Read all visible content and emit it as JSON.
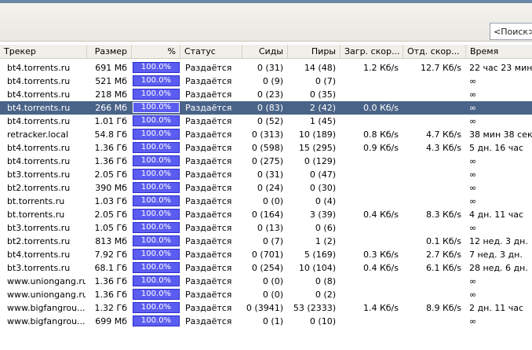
{
  "search": {
    "label": "<Поиск>"
  },
  "columns": {
    "tracker": "Трекер",
    "size": "Размер",
    "percent": "%",
    "status": "Статус",
    "seeds": "Сиды",
    "peers": "Пиры",
    "down": "Загр. скор...",
    "up": "Отд. скор...",
    "time": "Время"
  },
  "rows": [
    {
      "tracker": "bt4.torrents.ru",
      "size": "691 Мб",
      "percent": "100.0%",
      "status": "Раздаётся",
      "seeds": "0 (31)",
      "peers": "14 (48)",
      "down": "1.2 Кб/s",
      "up": "12.7 Кб/s",
      "time": "22 час 23 мин"
    },
    {
      "tracker": "bt4.torrents.ru",
      "size": "521 Мб",
      "percent": "100.0%",
      "status": "Раздаётся",
      "seeds": "0 (9)",
      "peers": "0 (7)",
      "down": "",
      "up": "",
      "time": "∞"
    },
    {
      "tracker": "bt4.torrents.ru",
      "size": "218 Мб",
      "percent": "100.0%",
      "status": "Раздаётся",
      "seeds": "0 (23)",
      "peers": "0 (35)",
      "down": "",
      "up": "",
      "time": "∞"
    },
    {
      "tracker": "bt4.torrents.ru",
      "size": "266 Мб",
      "percent": "100.0%",
      "status": "Раздаётся",
      "seeds": "0 (83)",
      "peers": "2 (42)",
      "down": "0.0 Кб/s",
      "up": "",
      "time": "∞",
      "selected": true
    },
    {
      "tracker": "bt4.torrents.ru",
      "size": "1.01 Гб",
      "percent": "100.0%",
      "status": "Раздаётся",
      "seeds": "0 (52)",
      "peers": "1 (45)",
      "down": "",
      "up": "",
      "time": "∞"
    },
    {
      "tracker": "retracker.local",
      "size": "54.8 Гб",
      "percent": "100.0%",
      "status": "Раздаётся",
      "seeds": "0 (313)",
      "peers": "10 (189)",
      "down": "0.8 Кб/s",
      "up": "4.7 Кб/s",
      "time": "38 мин 38 сек"
    },
    {
      "tracker": "bt4.torrents.ru",
      "size": "1.36 Гб",
      "percent": "100.0%",
      "status": "Раздаётся",
      "seeds": "0 (598)",
      "peers": "15 (295)",
      "down": "0.9 Кб/s",
      "up": "4.3 Кб/s",
      "time": "5 дн. 16 час"
    },
    {
      "tracker": "bt4.torrents.ru",
      "size": "1.36 Гб",
      "percent": "100.0%",
      "status": "Раздаётся",
      "seeds": "0 (275)",
      "peers": "0 (129)",
      "down": "",
      "up": "",
      "time": "∞"
    },
    {
      "tracker": "bt3.torrents.ru",
      "size": "2.05 Гб",
      "percent": "100.0%",
      "status": "Раздаётся",
      "seeds": "0 (31)",
      "peers": "0 (47)",
      "down": "",
      "up": "",
      "time": "∞"
    },
    {
      "tracker": "bt2.torrents.ru",
      "size": "390 Мб",
      "percent": "100.0%",
      "status": "Раздаётся",
      "seeds": "0 (24)",
      "peers": "0 (30)",
      "down": "",
      "up": "",
      "time": "∞"
    },
    {
      "tracker": "bt.torrents.ru",
      "size": "1.03 Гб",
      "percent": "100.0%",
      "status": "Раздаётся",
      "seeds": "0 (0)",
      "peers": "0 (4)",
      "down": "",
      "up": "",
      "time": "∞"
    },
    {
      "tracker": "bt.torrents.ru",
      "size": "2.05 Гб",
      "percent": "100.0%",
      "status": "Раздаётся",
      "seeds": "0 (164)",
      "peers": "3 (39)",
      "down": "0.4 Кб/s",
      "up": "8.3 Кб/s",
      "time": "4 дн. 11 час"
    },
    {
      "tracker": "bt3.torrents.ru",
      "size": "1.05 Гб",
      "percent": "100.0%",
      "status": "Раздаётся",
      "seeds": "0 (13)",
      "peers": "0 (6)",
      "down": "",
      "up": "",
      "time": "∞"
    },
    {
      "tracker": "bt2.torrents.ru",
      "size": "813 Мб",
      "percent": "100.0%",
      "status": "Раздаётся",
      "seeds": "0 (7)",
      "peers": "1 (2)",
      "down": "",
      "up": "0.1 Кб/s",
      "time": "12 нед. 3 дн."
    },
    {
      "tracker": "bt4.torrents.ru",
      "size": "7.92 Гб",
      "percent": "100.0%",
      "status": "Раздаётся",
      "seeds": "0 (701)",
      "peers": "5 (169)",
      "down": "0.3 Кб/s",
      "up": "2.7 Кб/s",
      "time": "7 нед. 3 дн."
    },
    {
      "tracker": "bt3.torrents.ru",
      "size": "68.1 Гб",
      "percent": "100.0%",
      "status": "Раздаётся",
      "seeds": "0 (254)",
      "peers": "10 (104)",
      "down": "0.4 Кб/s",
      "up": "6.1 Кб/s",
      "time": "28 нед. 6 дн."
    },
    {
      "tracker": "www.uniongang.ru",
      "size": "1.36 Гб",
      "percent": "100.0%",
      "status": "Раздаётся",
      "seeds": "0 (0)",
      "peers": "0 (8)",
      "down": "",
      "up": "",
      "time": "∞"
    },
    {
      "tracker": "www.uniongang.ru",
      "size": "1.36 Гб",
      "percent": "100.0%",
      "status": "Раздаётся",
      "seeds": "0 (0)",
      "peers": "0 (2)",
      "down": "",
      "up": "",
      "time": "∞"
    },
    {
      "tracker": "www.bigfangrou...",
      "size": "1.32 Гб",
      "percent": "100.0%",
      "status": "Раздаётся",
      "seeds": "0 (3941)",
      "peers": "53 (2333)",
      "down": "1.4 Кб/s",
      "up": "8.9 Кб/s",
      "time": "2 дн. 11 час"
    },
    {
      "tracker": "www.bigfangrou...",
      "size": "699 Мб",
      "percent": "100.0%",
      "status": "Раздаётся",
      "seeds": "0 (1)",
      "peers": "0 (10)",
      "down": "",
      "up": "",
      "time": "∞"
    }
  ],
  "colors": {
    "progress": "#5b5df1",
    "selection": "#4a6388"
  }
}
